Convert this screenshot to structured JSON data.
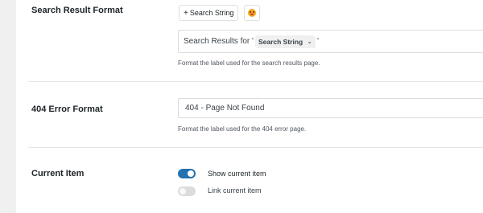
{
  "rows": {
    "search_result": {
      "label": "Search Result Format",
      "add_button_label": "Search String",
      "add_button_prefix": "+",
      "emoji_icon": "grinning-face-icon",
      "format_prefix": "Search Results for '",
      "token_label": "Search String",
      "format_suffix": "'",
      "help": "Format the label used for the search results page."
    },
    "error_404": {
      "label": "404 Error Format",
      "value": "404 - Page Not Found",
      "help": "Format the label used for the 404 error page."
    },
    "current_item": {
      "label": "Current Item",
      "toggles": [
        {
          "label": "Show current item",
          "checked": true
        },
        {
          "label": "Link current item",
          "checked": false
        }
      ]
    }
  },
  "colors": {
    "accent": "#2271b1",
    "toggle_off": "#dcdcde",
    "border": "#dcdcde",
    "side_strip": "#f0f0f1"
  }
}
